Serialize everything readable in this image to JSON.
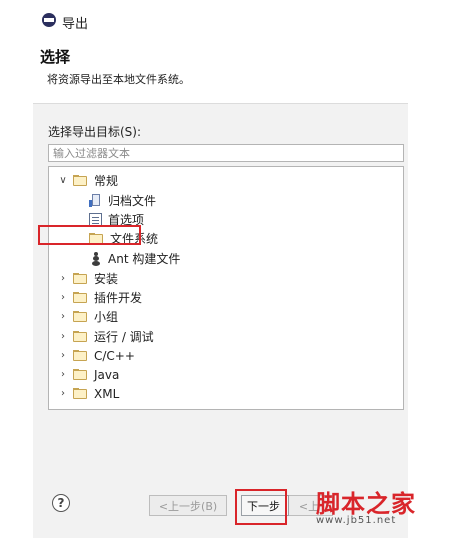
{
  "window": {
    "title": "导出"
  },
  "header": {
    "title": "选择",
    "description": "将资源导出至本地文件系统。"
  },
  "target": {
    "label": "选择导出目标(S):",
    "filter_placeholder": "输入过滤器文本"
  },
  "tree": {
    "items": [
      {
        "label": "常规",
        "expanded": true,
        "icon": "folder-icon"
      },
      {
        "label": "归档文件",
        "icon": "archive-icon"
      },
      {
        "label": "首选项",
        "icon": "preferences-icon"
      },
      {
        "label": "文件系统",
        "icon": "folder-icon",
        "highlighted": true
      },
      {
        "label": "Ant 构建文件",
        "icon": "ant-icon"
      },
      {
        "label": "安装",
        "expanded": false,
        "icon": "folder-icon"
      },
      {
        "label": "插件开发",
        "expanded": false,
        "icon": "folder-icon"
      },
      {
        "label": "小组",
        "expanded": false,
        "icon": "folder-icon"
      },
      {
        "label": "运行 / 调试",
        "expanded": false,
        "icon": "folder-icon"
      },
      {
        "label": "C/C++",
        "expanded": false,
        "icon": "folder-icon"
      },
      {
        "label": "Java",
        "expanded": false,
        "icon": "folder-icon"
      },
      {
        "label": "XML",
        "expanded": false,
        "icon": "folder-icon"
      }
    ]
  },
  "footer": {
    "help": "?",
    "back_label": "<上一步(B)",
    "next_label": "下一步",
    "finish_label": "<上"
  },
  "watermark": {
    "title": "脚本之家",
    "url": "www.jb51.net"
  },
  "colors": {
    "highlight": "#d9252a",
    "folder": "#fdf1c7"
  }
}
